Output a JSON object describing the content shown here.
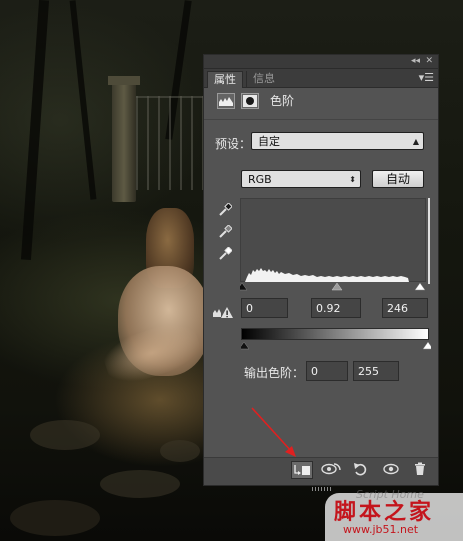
{
  "panel": {
    "tabs": [
      "属性",
      "信息"
    ],
    "header_title": "色阶",
    "preset_label": "预设：",
    "preset_value": "自定",
    "channel_value": "RGB",
    "auto_label": "自动",
    "input_levels": {
      "black": "0",
      "gamma": "0.92",
      "white": "246"
    },
    "output_label": "输出色阶：",
    "output_levels": {
      "black": "0",
      "white": "255"
    }
  },
  "watermark": {
    "title": "脚本之家",
    "url": "www.jb51.net",
    "ghost": "Script Home"
  },
  "colors": {
    "panel_bg": "#535353",
    "annotation_arrow": "#e02020",
    "watermark_red": "#c4151c"
  },
  "icons": [
    "collapse-icon",
    "close-icon",
    "panel-menu-icon",
    "levels-adjustment-icon",
    "layer-mask-icon",
    "black-eyedropper-icon",
    "gray-eyedropper-icon",
    "white-eyedropper-icon",
    "clipping-warning-icon",
    "clip-to-layer-icon",
    "view-previous-icon",
    "reset-icon",
    "visibility-icon",
    "trash-icon"
  ]
}
